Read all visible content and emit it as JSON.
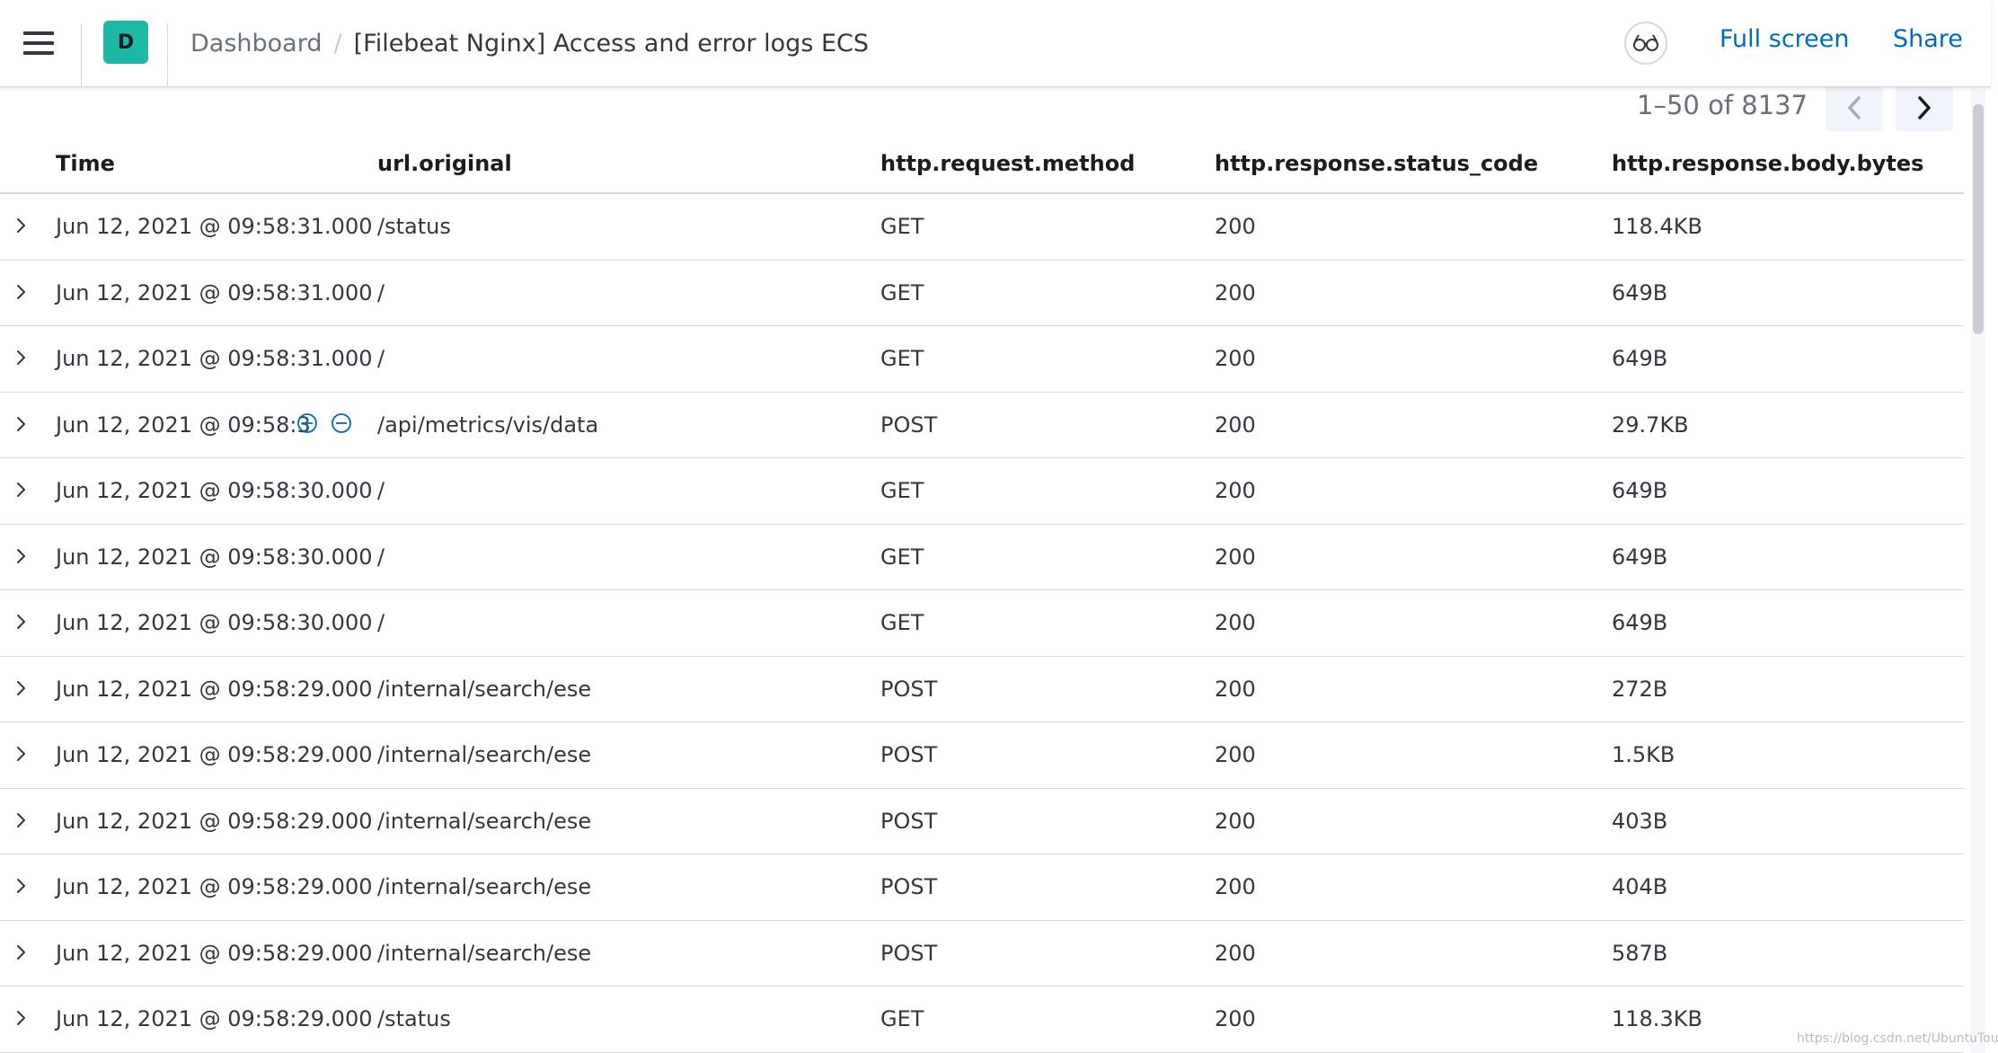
{
  "header": {
    "space_initial": "D",
    "breadcrumbs": {
      "parent": "Dashboard",
      "separator": "/",
      "current": "[Filebeat Nginx] Access and error logs ECS"
    },
    "full_screen_label": "Full screen",
    "share_label": "Share"
  },
  "pagination": {
    "range_text": "1–50 of 8137"
  },
  "table": {
    "columns": [
      "Time",
      "url.original",
      "http.request.method",
      "http.response.status_code",
      "http.response.body.bytes"
    ],
    "rows": [
      {
        "time": "Jun 12, 2021 @ 09:58:31.000",
        "url": "/status",
        "method": "GET",
        "status": "200",
        "bytes": "118.4KB"
      },
      {
        "time": "Jun 12, 2021 @ 09:58:31.000",
        "url": "/",
        "method": "GET",
        "status": "200",
        "bytes": "649B"
      },
      {
        "time": "Jun 12, 2021 @ 09:58:31.000",
        "url": "/",
        "method": "GET",
        "status": "200",
        "bytes": "649B"
      },
      {
        "time": "Jun 12, 2021 @ 09:58:3",
        "url": "/api/metrics/vis/data",
        "method": "POST",
        "status": "200",
        "bytes": "29.7KB"
      },
      {
        "time": "Jun 12, 2021 @ 09:58:30.000",
        "url": "/",
        "method": "GET",
        "status": "200",
        "bytes": "649B"
      },
      {
        "time": "Jun 12, 2021 @ 09:58:30.000",
        "url": "/",
        "method": "GET",
        "status": "200",
        "bytes": "649B"
      },
      {
        "time": "Jun 12, 2021 @ 09:58:30.000",
        "url": "/",
        "method": "GET",
        "status": "200",
        "bytes": "649B"
      },
      {
        "time": "Jun 12, 2021 @ 09:58:29.000",
        "url": "/internal/search/ese",
        "method": "POST",
        "status": "200",
        "bytes": "272B"
      },
      {
        "time": "Jun 12, 2021 @ 09:58:29.000",
        "url": "/internal/search/ese",
        "method": "POST",
        "status": "200",
        "bytes": "1.5KB"
      },
      {
        "time": "Jun 12, 2021 @ 09:58:29.000",
        "url": "/internal/search/ese",
        "method": "POST",
        "status": "200",
        "bytes": "403B"
      },
      {
        "time": "Jun 12, 2021 @ 09:58:29.000",
        "url": "/internal/search/ese",
        "method": "POST",
        "status": "200",
        "bytes": "404B"
      },
      {
        "time": "Jun 12, 2021 @ 09:58:29.000",
        "url": "/internal/search/ese",
        "method": "POST",
        "status": "200",
        "bytes": "587B"
      },
      {
        "time": "Jun 12, 2021 @ 09:58:29.000",
        "url": "/status",
        "method": "GET",
        "status": "200",
        "bytes": "118.3KB"
      }
    ]
  },
  "watermark": "https://blog.csdn.net/UbuntuTouch",
  "colors": {
    "link": "#006bb8",
    "avatar": "#1eb8a6",
    "border": "#d3dae6",
    "text": "#343741"
  },
  "icons": [
    "menu-icon",
    "glasses-icon",
    "chevron-left-icon",
    "chevron-right-icon",
    "expand-row-icon",
    "filter-for-value-icon",
    "filter-out-value-icon"
  ]
}
